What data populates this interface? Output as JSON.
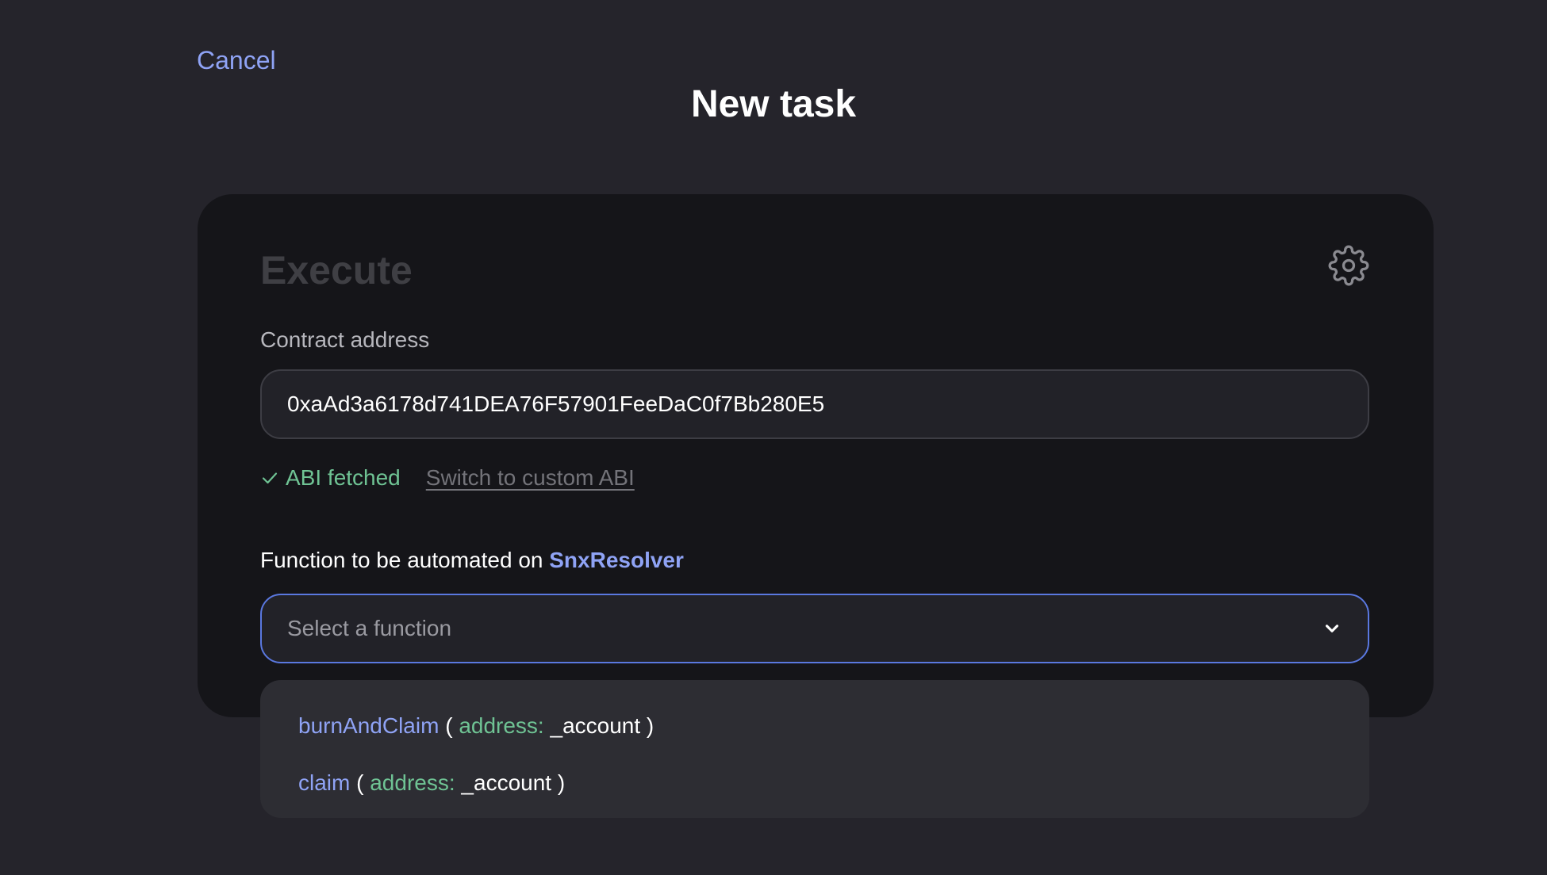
{
  "header": {
    "cancel_label": "Cancel",
    "title": "New task"
  },
  "card": {
    "title": "Execute",
    "settings_icon": "gear-icon",
    "contract_address_label": "Contract address",
    "contract_address_value": "0xaAd3a6178d741DEA76F57901FeeDaC0f7Bb280E5",
    "abi_status": "ABI fetched",
    "abi_status_icon": "check-icon",
    "switch_abi_label": "Switch to custom ABI",
    "function_label_prefix": "Function to be automated on",
    "contract_name": "SnxResolver",
    "function_select_placeholder": "Select a function",
    "chevron_icon": "chevron-down-icon"
  },
  "dropdown": {
    "options": [
      {
        "name": "burnAndClaim",
        "open": " ( ",
        "param_type": "address:",
        "param_name": " _account",
        "close": " )"
      },
      {
        "name": "claim",
        "open": " ( ",
        "param_type": "address:",
        "param_name": " _account",
        "close": " )"
      }
    ]
  },
  "colors": {
    "background": "#25242b",
    "card": "#151519",
    "accent": "#8fa3f5",
    "success": "#6fc394",
    "select_border": "#5a78e0"
  }
}
